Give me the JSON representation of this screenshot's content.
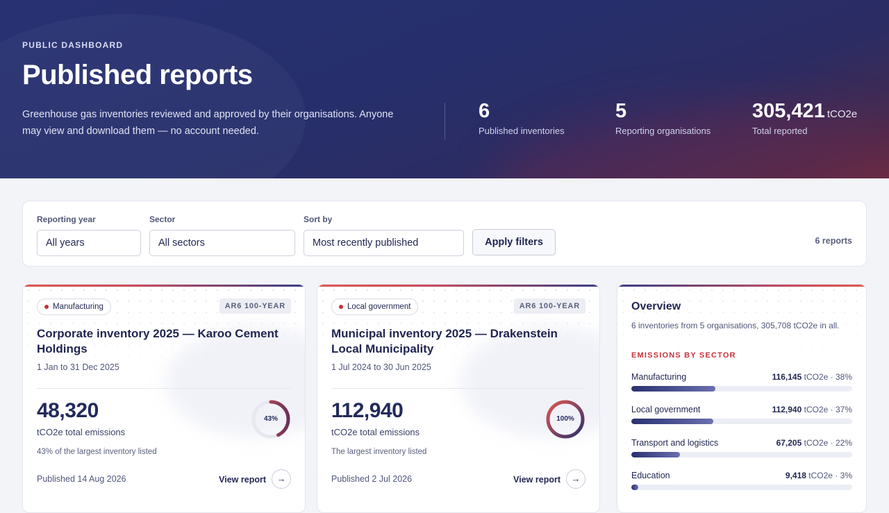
{
  "hero": {
    "kicker": "PUBLIC DASHBOARD",
    "title": "Published reports",
    "description": "Greenhouse gas inventories reviewed and approved by their organisations. Anyone may view and download them — no account needed.",
    "stats": [
      {
        "value": "6",
        "unit": "",
        "label": "Published inventories"
      },
      {
        "value": "5",
        "unit": "",
        "label": "Reporting organisations"
      },
      {
        "value": "305,421",
        "unit": "tCO2e",
        "label": "Total reported"
      }
    ]
  },
  "filters": {
    "year": {
      "label": "Reporting year",
      "value": "All years"
    },
    "sector": {
      "label": "Sector",
      "value": "All sectors"
    },
    "sort": {
      "label": "Sort by",
      "value": "Most recently published"
    },
    "apply_label": "Apply filters",
    "count": "6 reports"
  },
  "cards": [
    {
      "sector": "Manufacturing",
      "gwp": "AR6 100-YEAR",
      "title": "Corporate inventory 2025 — Karoo Cement Holdings",
      "period": "1 Jan to 31 Dec 2025",
      "value": "48,320",
      "unit": "tCO2e total emissions",
      "note": "43% of the largest inventory listed",
      "ring_label": "43%",
      "ring_fraction": 0.43,
      "published": "Published 14 Aug 2026",
      "view_label": "View report"
    },
    {
      "sector": "Local government",
      "gwp": "AR6 100-YEAR",
      "title": "Municipal inventory 2025 — Drakenstein Local Municipality",
      "period": "1 Jul 2024 to 30 Jun 2025",
      "value": "112,940",
      "unit": "tCO2e total emissions",
      "note": "The largest inventory listed",
      "ring_label": "100%",
      "ring_fraction": 1.0,
      "published": "Published 2 Jul 2026",
      "view_label": "View report"
    }
  ],
  "overview": {
    "title": "Overview",
    "subtitle": "6 inventories from 5 organisations, 305,708 tCO2e in all.",
    "kicker": "EMISSIONS BY SECTOR",
    "sectors": [
      {
        "name": "Manufacturing",
        "value": "116,145",
        "rest": "tCO2e · 38%",
        "fraction": 0.38
      },
      {
        "name": "Local government",
        "value": "112,940",
        "rest": "tCO2e · 37%",
        "fraction": 0.37
      },
      {
        "name": "Transport and logistics",
        "value": "67,205",
        "rest": "tCO2e · 22%",
        "fraction": 0.22
      },
      {
        "name": "Education",
        "value": "9,418",
        "rest": "tCO2e · 3%",
        "fraction": 0.03
      }
    ]
  },
  "colors": {
    "accent_red": "#c8323a",
    "navy": "#262f6b",
    "ring_start": "#e0574f",
    "ring_end": "#2b3170"
  },
  "icons": {
    "arrow": "arrow-right-icon",
    "dot": "status-dot-icon"
  }
}
